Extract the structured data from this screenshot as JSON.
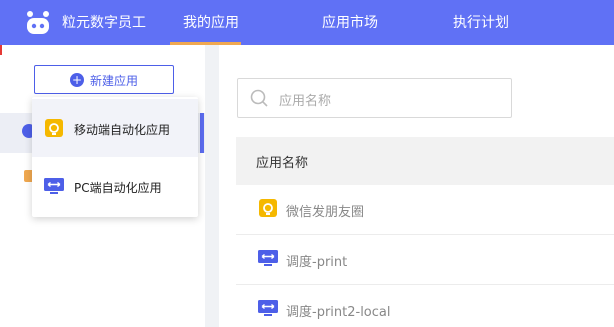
{
  "app": {
    "brand": "粒元数字员工"
  },
  "nav": {
    "tabs": [
      {
        "label": "我的应用",
        "active": true
      },
      {
        "label": "应用市场",
        "active": false
      },
      {
        "label": "执行计划",
        "active": false
      }
    ]
  },
  "sidebar": {
    "new_app_label": "新建应用"
  },
  "dropdown": {
    "items": [
      {
        "label": "移动端自动化应用",
        "icon": "mobile-app-icon"
      },
      {
        "label": "PC端自动化应用",
        "icon": "pc-app-icon"
      }
    ]
  },
  "main": {
    "search": {
      "placeholder": "应用名称"
    },
    "table": {
      "header": "应用名称",
      "rows": [
        {
          "name": "微信发朋友圈",
          "icon": "mobile-app-icon"
        },
        {
          "name": "调度-print",
          "icon": "pc-app-icon"
        },
        {
          "name": "调度-print2-local",
          "icon": "pc-app-icon"
        }
      ]
    }
  },
  "colors": {
    "primary": "#6071f5",
    "accent": "#f0a850",
    "mobile_icon": "#f5b800",
    "pc_icon": "#4d5fe8"
  }
}
